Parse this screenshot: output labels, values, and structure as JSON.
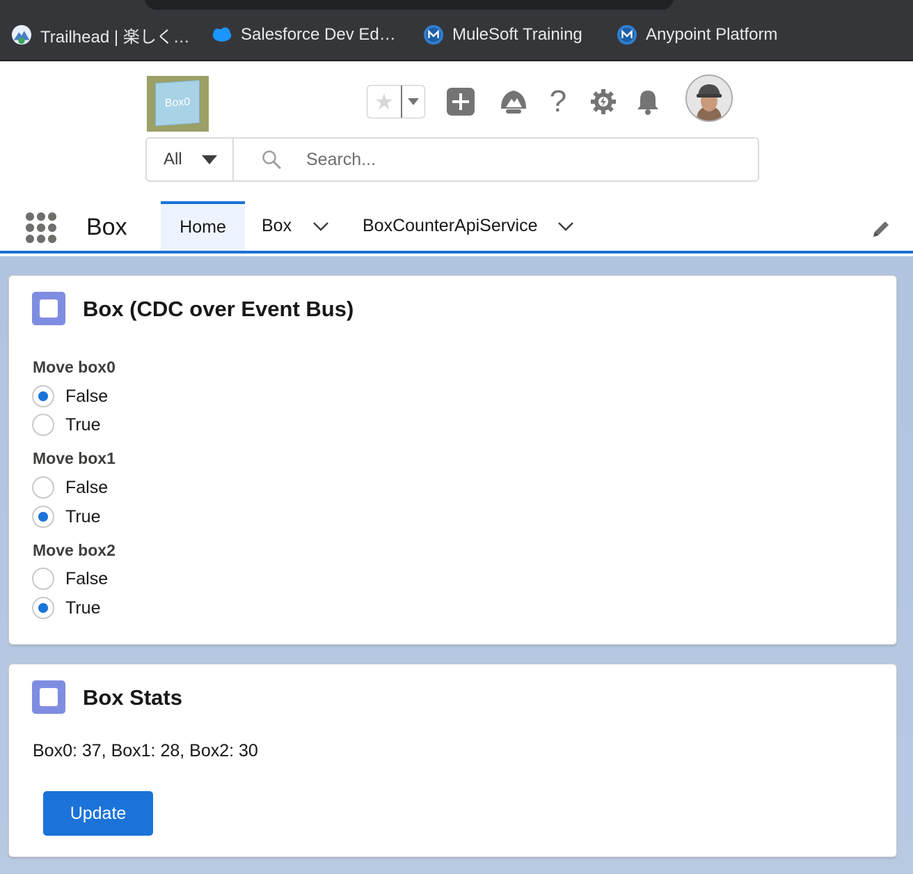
{
  "bookmarks": [
    {
      "label": "Trailhead | 楽しく…",
      "icon": "trailhead-icon",
      "color": "#4a7fc4"
    },
    {
      "label": "Salesforce Dev Ed…",
      "icon": "salesforce-cloud-icon",
      "color": "#1b96ff"
    },
    {
      "label": "MuleSoft Training",
      "icon": "mulesoft-icon",
      "color": "#2f7fd0"
    },
    {
      "label": "Anypoint Platform",
      "icon": "mulesoft-icon",
      "color": "#2f7fd0"
    }
  ],
  "header": {
    "logo_text": "Box0",
    "search": {
      "scope": "All",
      "placeholder": "Search..."
    },
    "icons": [
      "favorites-star-icon",
      "add-icon",
      "trailhead-guidance-icon",
      "help-icon",
      "setup-gear-icon",
      "notifications-bell-icon",
      "user-avatar"
    ]
  },
  "nav": {
    "app_name": "Box",
    "tabs": [
      {
        "label": "Home",
        "active": true
      },
      {
        "label": "Box",
        "active": false,
        "has_menu": true
      },
      {
        "label": "BoxCounterApiService",
        "active": false,
        "has_menu": true
      }
    ]
  },
  "cards": {
    "box_control": {
      "title": "Box (CDC over Event Bus)",
      "groups": [
        {
          "label": "Move box0",
          "options": [
            "False",
            "True"
          ],
          "selected": "False"
        },
        {
          "label": "Move box1",
          "options": [
            "False",
            "True"
          ],
          "selected": "True"
        },
        {
          "label": "Move box2",
          "options": [
            "False",
            "True"
          ],
          "selected": "True"
        }
      ]
    },
    "box_stats": {
      "title": "Box Stats",
      "stats_text": "Box0: 37, Box1: 28, Box2: 30",
      "button_label": "Update"
    }
  },
  "colors": {
    "brand_blue": "#1b73d9",
    "card_icon": "#7f8de1",
    "bookmark_bar": "#35363a"
  }
}
